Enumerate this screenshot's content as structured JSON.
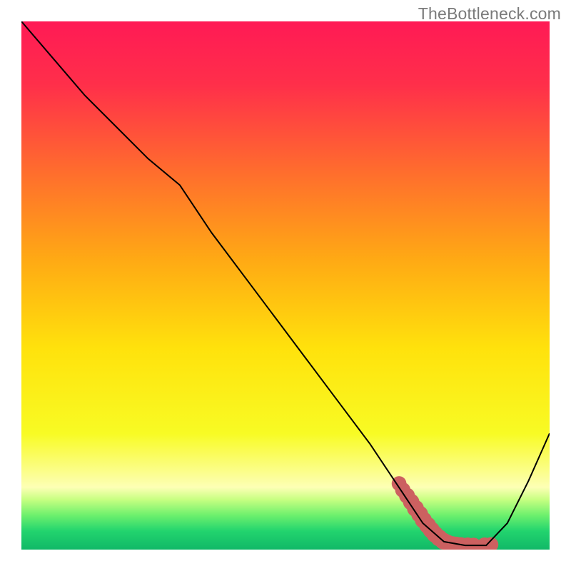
{
  "watermark": "TheBottleneck.com",
  "chart_data": {
    "type": "line",
    "title": "",
    "xlabel": "",
    "ylabel": "",
    "xlim": [
      0,
      100
    ],
    "ylim": [
      0,
      100
    ],
    "curve_x": [
      0,
      6,
      12,
      18,
      24,
      30,
      36,
      42,
      48,
      54,
      60,
      66,
      72,
      76,
      80,
      84,
      88,
      92,
      96,
      100
    ],
    "curve_y": [
      100,
      93,
      86,
      80,
      74,
      69,
      60,
      52,
      44,
      36,
      28,
      20,
      11,
      5,
      1.5,
      0.8,
      0.8,
      5,
      13,
      22
    ],
    "highlight_points": [
      {
        "x": 71.5,
        "y": 12.5,
        "r": 1.4
      },
      {
        "x": 72.2,
        "y": 11.3,
        "r": 1.45
      },
      {
        "x": 73.0,
        "y": 10.2,
        "r": 1.5
      },
      {
        "x": 73.8,
        "y": 9.0,
        "r": 1.55
      },
      {
        "x": 74.6,
        "y": 7.8,
        "r": 1.6
      },
      {
        "x": 75.4,
        "y": 6.7,
        "r": 1.6
      },
      {
        "x": 76.1,
        "y": 5.6,
        "r": 1.6
      },
      {
        "x": 76.9,
        "y": 4.6,
        "r": 1.6
      },
      {
        "x": 77.6,
        "y": 3.7,
        "r": 1.6
      },
      {
        "x": 78.3,
        "y": 2.9,
        "r": 1.6
      },
      {
        "x": 79.1,
        "y": 2.2,
        "r": 1.6
      },
      {
        "x": 79.9,
        "y": 1.6,
        "r": 1.6
      },
      {
        "x": 80.7,
        "y": 1.2,
        "r": 1.6
      },
      {
        "x": 81.5,
        "y": 0.95,
        "r": 1.6
      },
      {
        "x": 82.3,
        "y": 0.85,
        "r": 1.6
      },
      {
        "x": 83.2,
        "y": 0.8,
        "r": 1.55
      },
      {
        "x": 84.5,
        "y": 0.8,
        "r": 1.5
      },
      {
        "x": 85.6,
        "y": 0.8,
        "r": 1.45
      },
      {
        "x": 87.7,
        "y": 0.85,
        "r": 1.45
      },
      {
        "x": 88.9,
        "y": 0.95,
        "r": 1.4
      }
    ],
    "gradient_stops": [
      {
        "offset": 0.0,
        "color": "#ff1a55"
      },
      {
        "offset": 0.12,
        "color": "#ff2f4a"
      },
      {
        "offset": 0.28,
        "color": "#ff6b2e"
      },
      {
        "offset": 0.45,
        "color": "#ffa914"
      },
      {
        "offset": 0.62,
        "color": "#ffe20c"
      },
      {
        "offset": 0.78,
        "color": "#f8fb24"
      },
      {
        "offset": 0.882,
        "color": "#fdffb5"
      },
      {
        "offset": 0.905,
        "color": "#c8ff82"
      },
      {
        "offset": 0.935,
        "color": "#6df06d"
      },
      {
        "offset": 0.965,
        "color": "#22d46e"
      },
      {
        "offset": 1.0,
        "color": "#11b867"
      }
    ],
    "colors": {
      "curve": "#000000",
      "highlight": "#cc6060",
      "axis": "#000000"
    }
  }
}
